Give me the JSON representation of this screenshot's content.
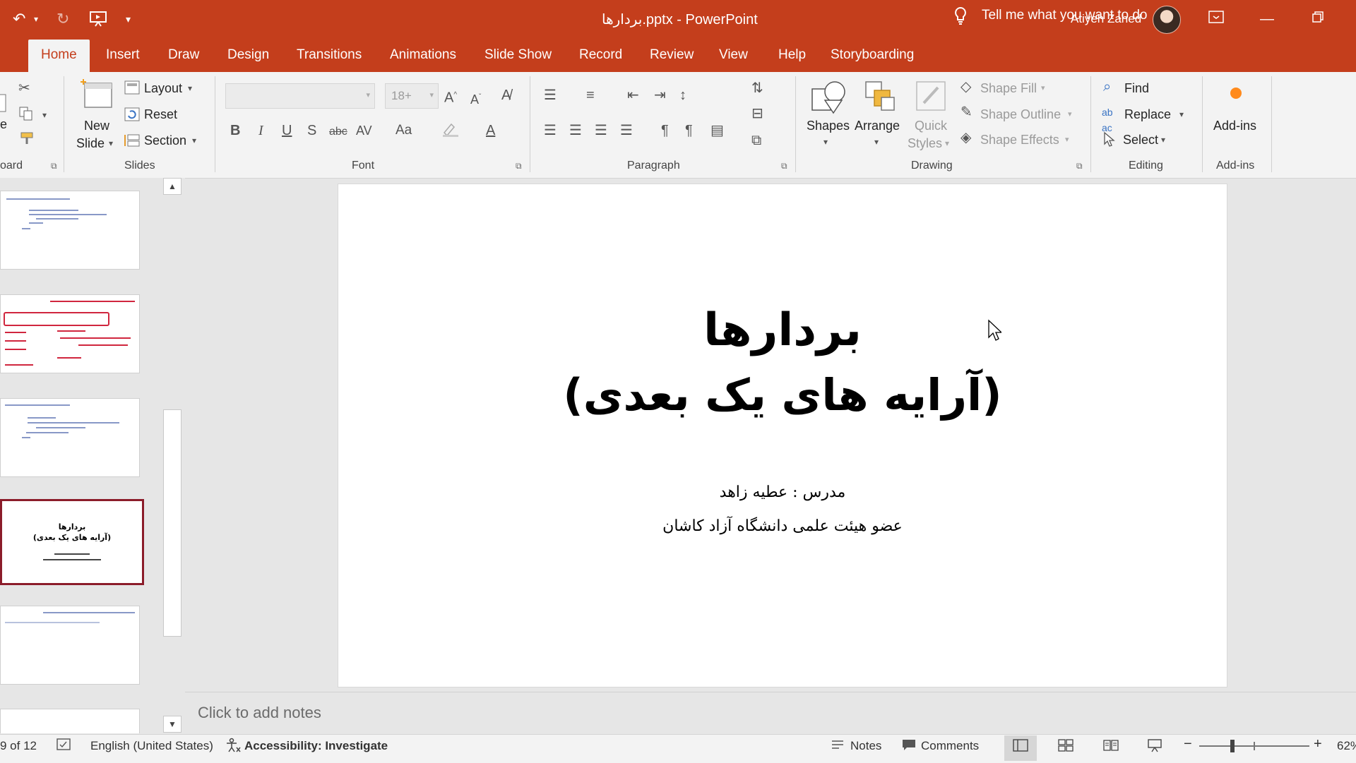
{
  "window": {
    "doc_title": "بردارها.pptx  -  PowerPoint",
    "user_name": "Atiyeh Zahed"
  },
  "quick_access": {
    "undo": "↶",
    "redo": "↻",
    "customize": "▾"
  },
  "tabs": [
    {
      "label": "Home",
      "active": true
    },
    {
      "label": "Insert"
    },
    {
      "label": "Draw"
    },
    {
      "label": "Design"
    },
    {
      "label": "Transitions"
    },
    {
      "label": "Animations"
    },
    {
      "label": "Slide Show"
    },
    {
      "label": "Record"
    },
    {
      "label": "Review"
    },
    {
      "label": "View"
    },
    {
      "label": "Help"
    },
    {
      "label": "Storyboarding"
    }
  ],
  "tell_me": "Tell me what you want to do",
  "ribbon": {
    "clipboard": {
      "label": "oard",
      "paste_partial": "e"
    },
    "slides": {
      "label": "Slides",
      "new_slide": "New",
      "new_slide_2": "Slide",
      "layout": "Layout",
      "reset": "Reset",
      "section": "Section"
    },
    "font": {
      "label": "Font",
      "font_name": "",
      "font_size": "18+",
      "bold": "B",
      "italic": "I",
      "underline": "U",
      "strike": "S",
      "abc": "abc",
      "av": "AV",
      "aa": "Aa",
      "font_color": "A"
    },
    "paragraph": {
      "label": "Paragraph"
    },
    "drawing": {
      "label": "Drawing",
      "shapes": "Shapes",
      "arrange": "Arrange",
      "quick_styles": "Quick",
      "quick_styles_2": "Styles",
      "shape_fill": "Shape Fill",
      "shape_outline": "Shape Outline",
      "shape_effects": "Shape Effects"
    },
    "editing": {
      "label": "Editing",
      "find": "Find",
      "replace": "Replace",
      "select": "Select"
    },
    "addins": {
      "label": "Add-ins",
      "button": "Add-ins"
    }
  },
  "slide": {
    "title_line1": "بردارها",
    "title_line2": "(آرایه های یک بعدی)",
    "subtitle_line1": "مدرس : عطیه زاهد",
    "subtitle_line2": "عضو هیئت علمی دانشگاه آزاد کاشان"
  },
  "thumbnails": {
    "selected_title1": "بردارها",
    "selected_title2": "(آرایه های یک بعدی)"
  },
  "notes_placeholder": "Click to add notes",
  "status": {
    "slide_counter": "9 of 12",
    "language": "English (United States)",
    "accessibility": "Accessibility: Investigate",
    "notes": "Notes",
    "comments": "Comments",
    "zoom_value": "62%"
  },
  "colors": {
    "accent": "#c43e1c",
    "thumb_selected": "#8b1c2a"
  }
}
